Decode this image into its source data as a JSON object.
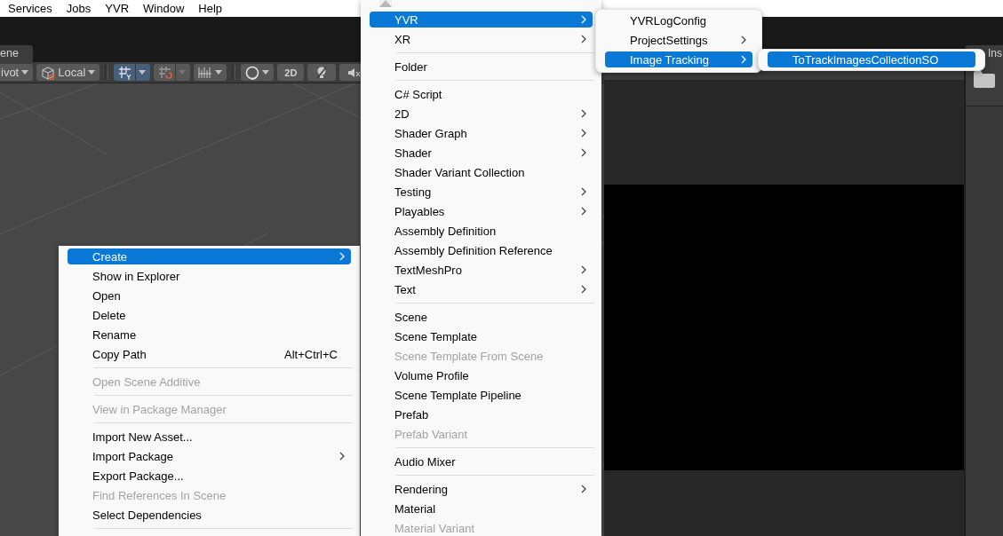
{
  "menubar": {
    "items": [
      "Services",
      "Jobs",
      "YVR",
      "Window",
      "Help"
    ]
  },
  "scene_tab": {
    "label": "ene"
  },
  "scene_toolbar": {
    "pivot": "ivot",
    "space": "Local",
    "grid_snapping": {
      "on": true
    },
    "mode_2d": "2D"
  },
  "inspector_tab": {
    "label": "Ins"
  },
  "menus": [
    {
      "scroll_up_arrow": false,
      "items": [
        {
          "kind": "item",
          "label": "Create",
          "submenu": true,
          "disabled": false,
          "selected": true
        },
        {
          "kind": "item",
          "label": "Show in Explorer",
          "submenu": false,
          "disabled": false,
          "selected": false
        },
        {
          "kind": "item",
          "label": "Open",
          "submenu": false,
          "disabled": false,
          "selected": false
        },
        {
          "kind": "item",
          "label": "Delete",
          "submenu": false,
          "disabled": false,
          "selected": false
        },
        {
          "kind": "item",
          "label": "Rename",
          "submenu": false,
          "disabled": false,
          "selected": false
        },
        {
          "kind": "item",
          "label": "Copy Path",
          "shortcut": "Alt+Ctrl+C",
          "submenu": false,
          "disabled": false,
          "selected": false
        },
        {
          "kind": "separator"
        },
        {
          "kind": "item",
          "label": "Open Scene Additive",
          "submenu": false,
          "disabled": true,
          "selected": false
        },
        {
          "kind": "separator"
        },
        {
          "kind": "item",
          "label": "View in Package Manager",
          "submenu": false,
          "disabled": true,
          "selected": false
        },
        {
          "kind": "separator"
        },
        {
          "kind": "item",
          "label": "Import New Asset...",
          "submenu": false,
          "disabled": false,
          "selected": false
        },
        {
          "kind": "item",
          "label": "Import Package",
          "submenu": true,
          "disabled": false,
          "selected": false
        },
        {
          "kind": "item",
          "label": "Export Package...",
          "submenu": false,
          "disabled": false,
          "selected": false
        },
        {
          "kind": "item",
          "label": "Find References In Scene",
          "submenu": false,
          "disabled": true,
          "selected": false
        },
        {
          "kind": "item",
          "label": "Select Dependencies",
          "submenu": false,
          "disabled": false,
          "selected": false
        },
        {
          "kind": "separator"
        }
      ]
    },
    {
      "scroll_up_arrow": true,
      "items": [
        {
          "kind": "item",
          "label": "YVR",
          "submenu": true,
          "disabled": false,
          "selected": true
        },
        {
          "kind": "item",
          "label": "XR",
          "submenu": true,
          "disabled": false,
          "selected": false
        },
        {
          "kind": "separator"
        },
        {
          "kind": "item",
          "label": "Folder",
          "submenu": false,
          "disabled": false,
          "selected": false
        },
        {
          "kind": "separator"
        },
        {
          "kind": "item",
          "label": "C# Script",
          "submenu": false,
          "disabled": false,
          "selected": false
        },
        {
          "kind": "item",
          "label": "2D",
          "submenu": true,
          "disabled": false,
          "selected": false
        },
        {
          "kind": "item",
          "label": "Shader Graph",
          "submenu": true,
          "disabled": false,
          "selected": false
        },
        {
          "kind": "item",
          "label": "Shader",
          "submenu": true,
          "disabled": false,
          "selected": false
        },
        {
          "kind": "item",
          "label": "Shader Variant Collection",
          "submenu": false,
          "disabled": false,
          "selected": false
        },
        {
          "kind": "item",
          "label": "Testing",
          "submenu": true,
          "disabled": false,
          "selected": false
        },
        {
          "kind": "item",
          "label": "Playables",
          "submenu": true,
          "disabled": false,
          "selected": false
        },
        {
          "kind": "item",
          "label": "Assembly Definition",
          "submenu": false,
          "disabled": false,
          "selected": false
        },
        {
          "kind": "item",
          "label": "Assembly Definition Reference",
          "submenu": false,
          "disabled": false,
          "selected": false
        },
        {
          "kind": "item",
          "label": "TextMeshPro",
          "submenu": true,
          "disabled": false,
          "selected": false
        },
        {
          "kind": "item",
          "label": "Text",
          "submenu": true,
          "disabled": false,
          "selected": false
        },
        {
          "kind": "separator"
        },
        {
          "kind": "item",
          "label": "Scene",
          "submenu": false,
          "disabled": false,
          "selected": false
        },
        {
          "kind": "item",
          "label": "Scene Template",
          "submenu": false,
          "disabled": false,
          "selected": false
        },
        {
          "kind": "item",
          "label": "Scene Template From Scene",
          "submenu": false,
          "disabled": true,
          "selected": false
        },
        {
          "kind": "item",
          "label": "Volume Profile",
          "submenu": false,
          "disabled": false,
          "selected": false
        },
        {
          "kind": "item",
          "label": "Scene Template Pipeline",
          "submenu": false,
          "disabled": false,
          "selected": false
        },
        {
          "kind": "item",
          "label": "Prefab",
          "submenu": false,
          "disabled": false,
          "selected": false
        },
        {
          "kind": "item",
          "label": "Prefab Variant",
          "submenu": false,
          "disabled": true,
          "selected": false
        },
        {
          "kind": "separator"
        },
        {
          "kind": "item",
          "label": "Audio Mixer",
          "submenu": false,
          "disabled": false,
          "selected": false
        },
        {
          "kind": "separator"
        },
        {
          "kind": "item",
          "label": "Rendering",
          "submenu": true,
          "disabled": false,
          "selected": false
        },
        {
          "kind": "item",
          "label": "Material",
          "submenu": false,
          "disabled": false,
          "selected": false
        },
        {
          "kind": "item",
          "label": "Material Variant",
          "submenu": false,
          "disabled": true,
          "selected": false
        }
      ]
    },
    {
      "scroll_up_arrow": false,
      "items": [
        {
          "kind": "item",
          "label": "YVRLogConfig",
          "submenu": false,
          "disabled": false,
          "selected": false
        },
        {
          "kind": "item",
          "label": "ProjectSettings",
          "submenu": true,
          "disabled": false,
          "selected": false
        },
        {
          "kind": "item",
          "label": "Image Tracking",
          "submenu": true,
          "disabled": false,
          "selected": true
        }
      ]
    },
    {
      "scroll_up_arrow": false,
      "items": [
        {
          "kind": "item",
          "label": "ToTrackImagesCollectionSO",
          "submenu": false,
          "disabled": false,
          "selected": true
        }
      ]
    }
  ]
}
